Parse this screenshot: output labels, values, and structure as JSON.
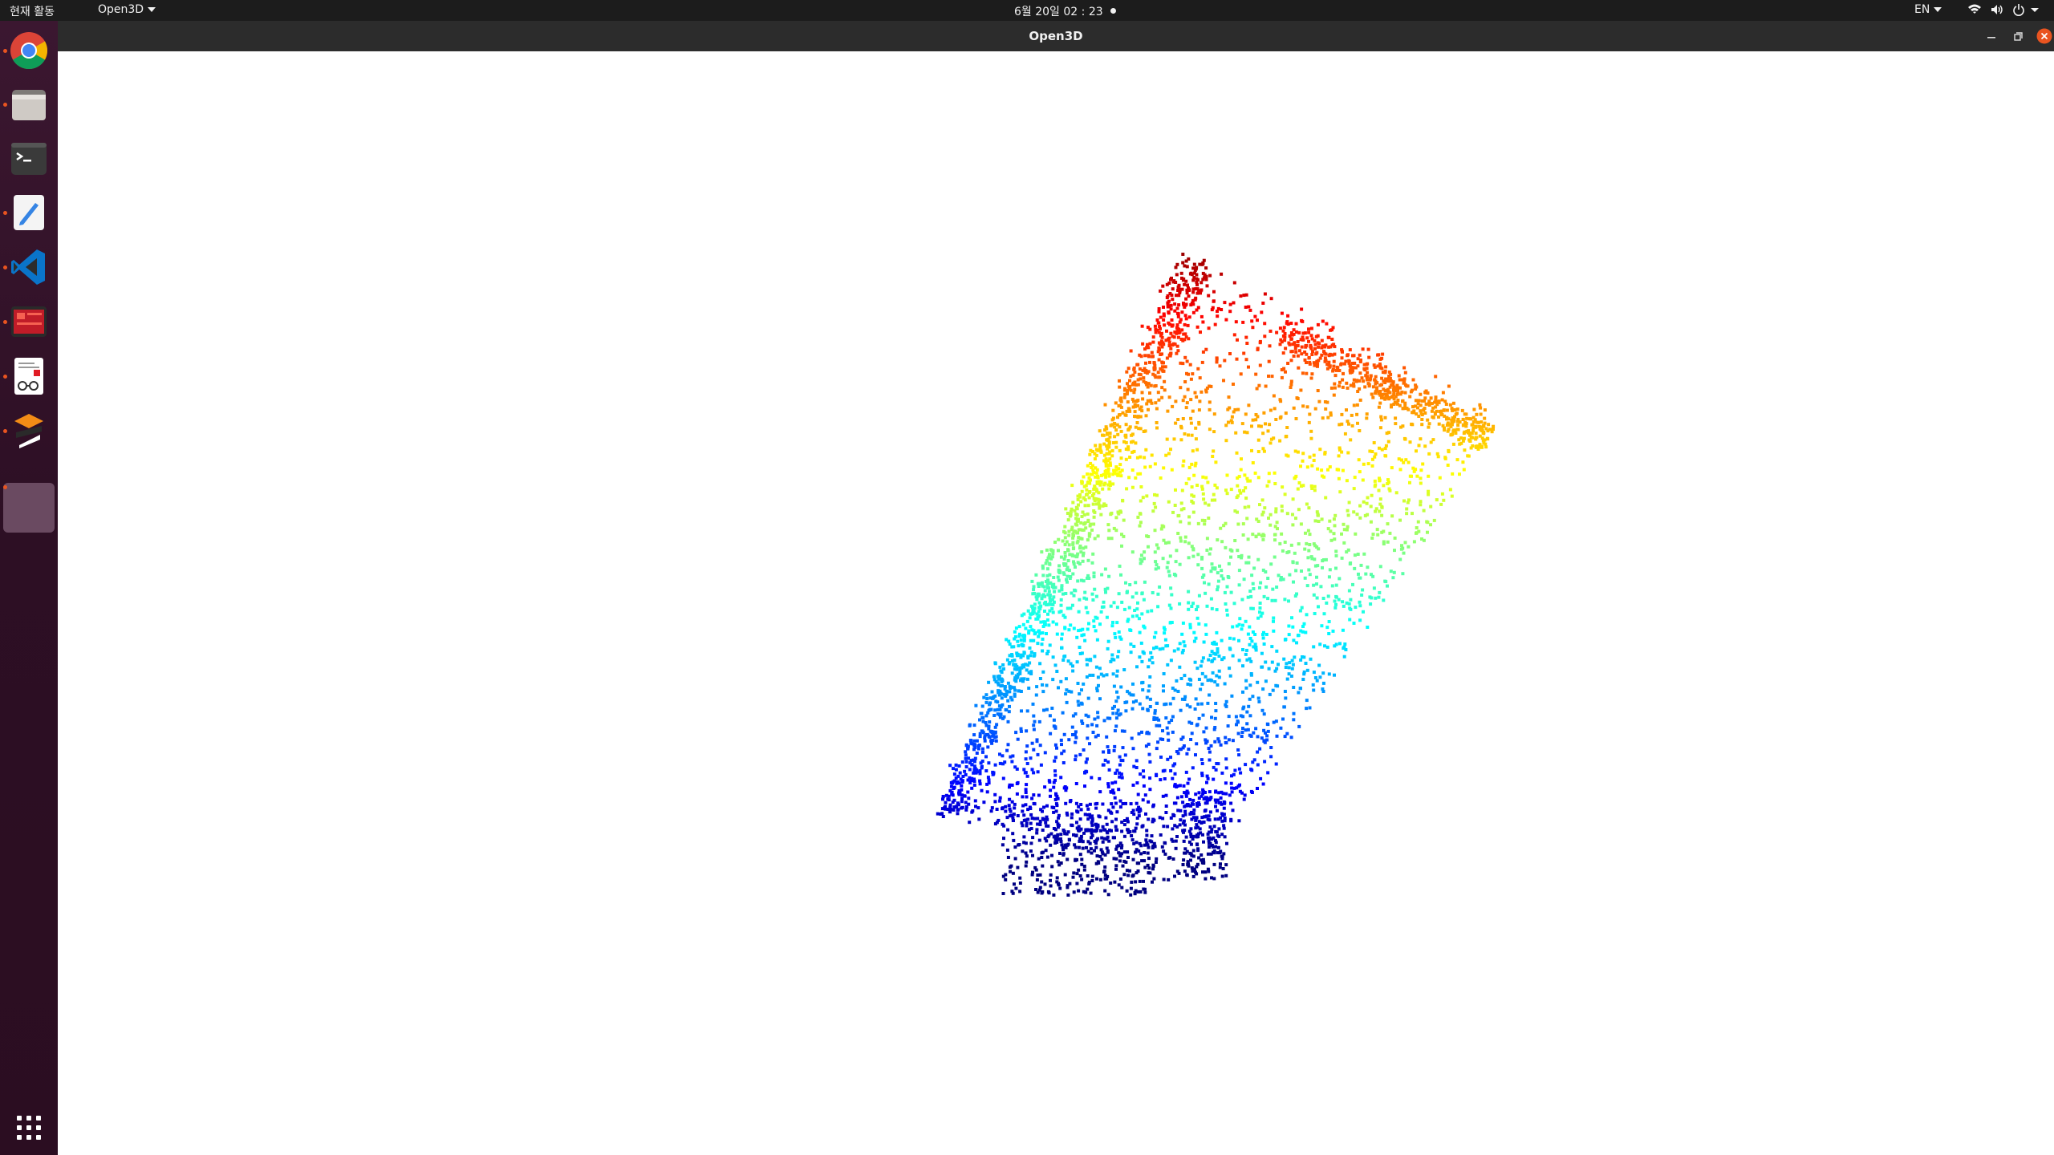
{
  "topbar": {
    "activities_label": "현재 활동",
    "app_menu_label": "Open3D",
    "clock": "6월 20일  02 : 23",
    "language": "EN"
  },
  "dock": {
    "apps": [
      {
        "name": "chrome-icon",
        "running": true
      },
      {
        "name": "files-icon",
        "running": true
      },
      {
        "name": "terminal-icon",
        "running": false
      },
      {
        "name": "text-editor-icon",
        "running": true
      },
      {
        "name": "vscode-icon",
        "running": true
      },
      {
        "name": "system-monitor-icon",
        "running": true
      },
      {
        "name": "document-viewer-icon",
        "running": true
      },
      {
        "name": "sublime-merge-icon",
        "running": true
      },
      {
        "name": "open3d-window-icon",
        "running": true,
        "selected": true
      }
    ],
    "show_apps_icon": "app-grid-icon"
  },
  "window": {
    "title": "Open3D",
    "controls": [
      "minimize-icon",
      "maximize-icon",
      "close-icon"
    ]
  },
  "point_cloud": {
    "colormap": "jet",
    "colors": {
      "top": "#ff0000",
      "upper": "#ff8000",
      "middle": "#ffff00",
      "lower_mid": "#00ffd0",
      "bottom": "#0030ff"
    }
  }
}
